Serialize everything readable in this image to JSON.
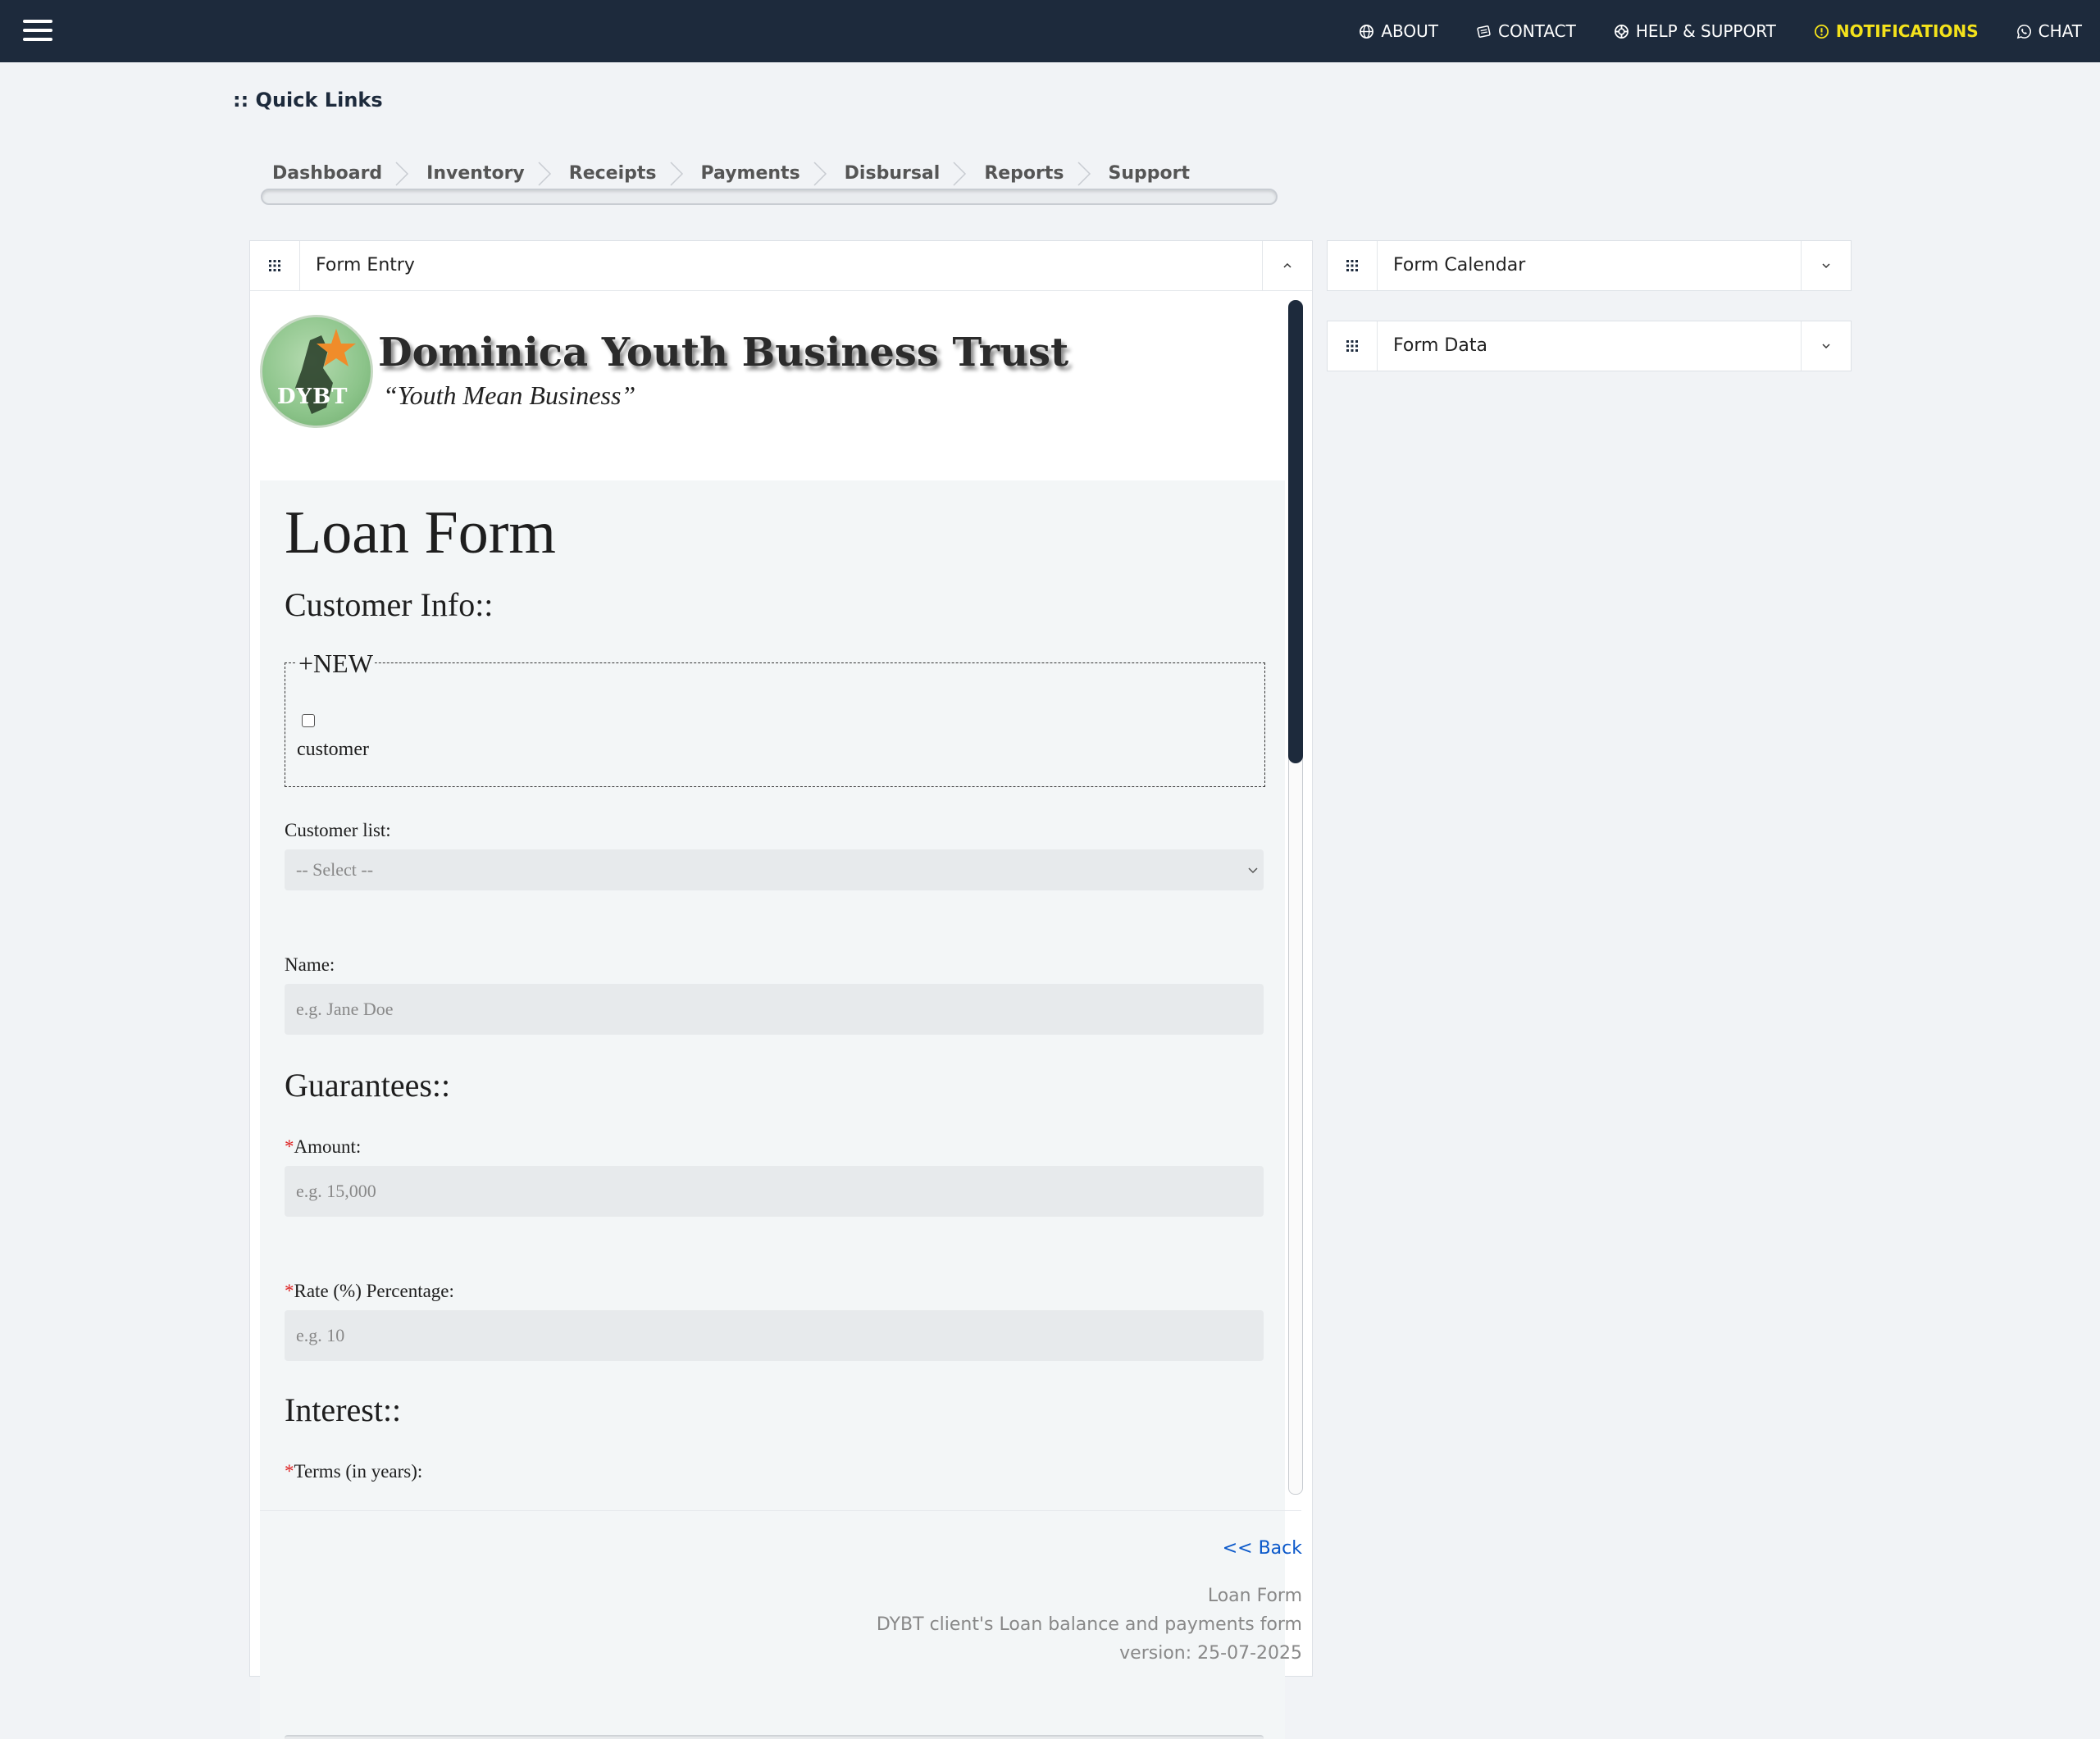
{
  "topnav": {
    "items": [
      {
        "label": "ABOUT",
        "icon": "globe-icon"
      },
      {
        "label": "CONTACT",
        "icon": "contact-card-icon"
      },
      {
        "label": "HELP & SUPPORT",
        "icon": "lifebuoy-icon"
      },
      {
        "label": "NOTIFICATIONS",
        "icon": "alert-circle-icon"
      },
      {
        "label": "CHAT",
        "icon": "whatsapp-icon"
      }
    ],
    "notification_color": "#f4e21b"
  },
  "quick_links": {
    "title": ":: Quick Links",
    "items": [
      "Dashboard",
      "Inventory",
      "Receipts",
      "Payments",
      "Disbursal",
      "Reports",
      "Support"
    ]
  },
  "panels": {
    "form_entry": "Form Entry",
    "form_calendar": "Form Calendar",
    "form_data": "Form Data"
  },
  "logo": {
    "badge_text": "DYBT",
    "title": "Dominica Youth Business Trust",
    "slogan": "“Youth Mean Business”"
  },
  "form": {
    "title": "Loan Form",
    "customer_section": "Customer Info::",
    "new_legend": "+NEW",
    "new_checkbox_label": "customer",
    "customer_list_label": "Customer list:",
    "customer_list_selected": "-- Select --",
    "name_label": "Name:",
    "name_placeholder": "e.g. Jane Doe",
    "guarantees_section": "Guarantees::",
    "amount_label": "Amount:",
    "amount_placeholder": "e.g. 15,000",
    "rate_label": "Rate (%) Percentage:",
    "rate_placeholder": "e.g. 10",
    "interest_section": "Interest::",
    "terms_label": "Terms (in years):",
    "required_mark": "*"
  },
  "footer": {
    "back": "<< Back",
    "form_name": "Loan Form",
    "description": "DYBT client's Loan balance and payments form",
    "version": "version: 25-07-2025"
  },
  "colors": {
    "topbar": "#1d2a3c",
    "link": "#0a58ca",
    "required": "#dd2222"
  }
}
